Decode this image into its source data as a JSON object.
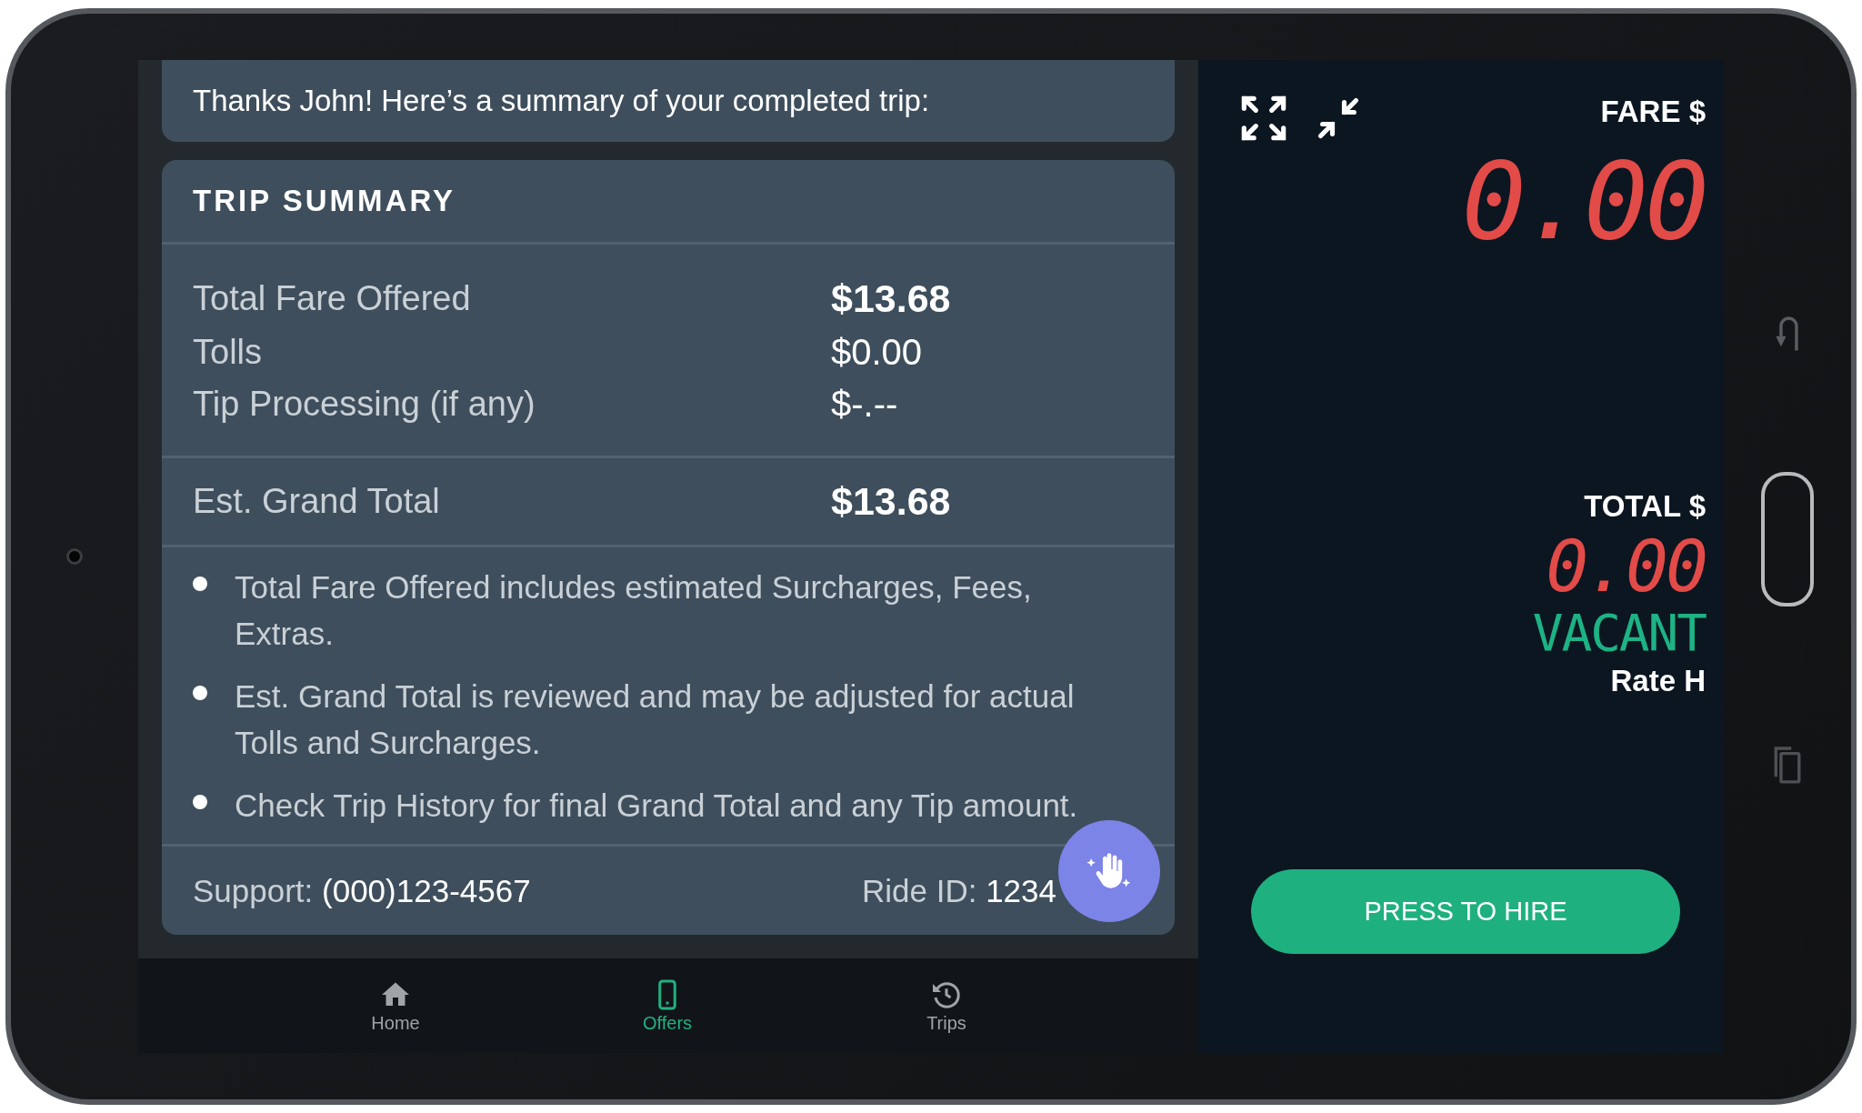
{
  "greeting": "Thanks John! Here’s a summary of your completed trip:",
  "trip_summary": {
    "title": "TRIP SUMMARY",
    "rows": [
      {
        "label": "Total Fare Offered",
        "value": "$13.68",
        "bold": true
      },
      {
        "label": "Tolls",
        "value": "$0.00",
        "bold": false
      },
      {
        "label": "Tip Processing (if any)",
        "value": "$-.--",
        "bold": false
      }
    ],
    "grand_total": {
      "label": "Est. Grand Total",
      "value": "$13.68"
    },
    "notes": [
      "Total Fare Offered includes estimated Surcharges, Fees, Extras.",
      "Est. Grand Total is reviewed and may be adjusted for actual Tolls and Surcharges.",
      "Check Trip History for final Grand Total and any Tip amount."
    ],
    "support": {
      "label": "Support:",
      "value": "(000)123-4567"
    },
    "ride_id": {
      "label": "Ride ID:",
      "value": "1234"
    }
  },
  "nav": [
    {
      "label": "Home",
      "selected": false
    },
    {
      "label": "Offers",
      "selected": true
    },
    {
      "label": "Trips",
      "selected": false
    }
  ],
  "meter": {
    "fare": {
      "label": "FARE $",
      "amount": "0.00"
    },
    "total": {
      "label": "TOTAL $",
      "amount": "0.00"
    },
    "status": "VACANT",
    "rate": "Rate H",
    "hire_button": "PRESS TO HIRE"
  }
}
